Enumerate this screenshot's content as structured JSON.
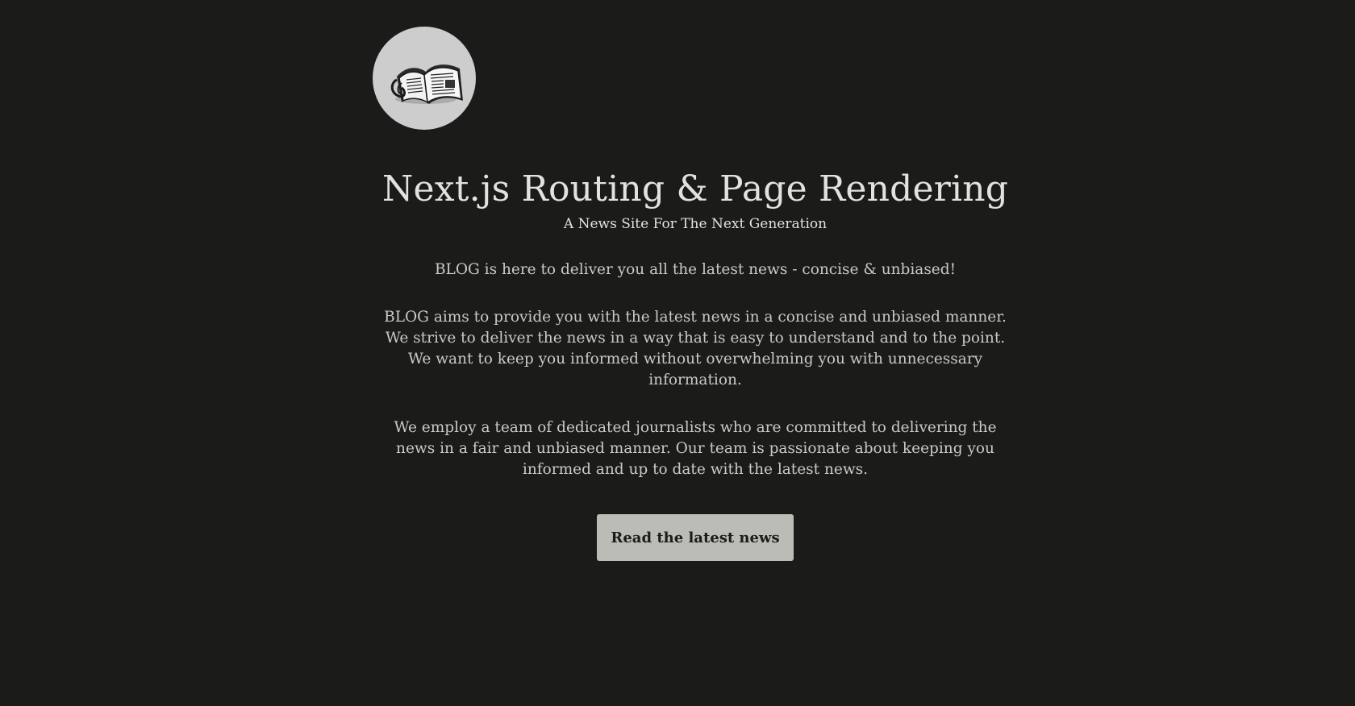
{
  "header": {
    "logo_icon": "newspaper-icon"
  },
  "hero": {
    "title": "Next.js Routing & Page Rendering",
    "subtitle": "A News Site For The Next Generation"
  },
  "intro": {
    "tagline": "BLOG is here to deliver you all the latest news - concise & unbiased!",
    "paragraph_1": "BLOG aims to provide you with the latest news in a concise and unbiased manner. We strive to deliver the news in a way that is easy to understand and to the point. We want to keep you informed without overwhelming you with unnecessary information.",
    "paragraph_2": "We employ a team of dedicated journalists who are committed to delivering the news in a fair and unbiased manner. Our team is passionate about keeping you informed and up to date with the latest news."
  },
  "cta": {
    "label": "Read the latest news"
  },
  "colors": {
    "background": "#1b1b1a",
    "text": "#d9d9d6",
    "button_bg": "#bcbcb6",
    "logo_bg": "#cdcdcd"
  }
}
